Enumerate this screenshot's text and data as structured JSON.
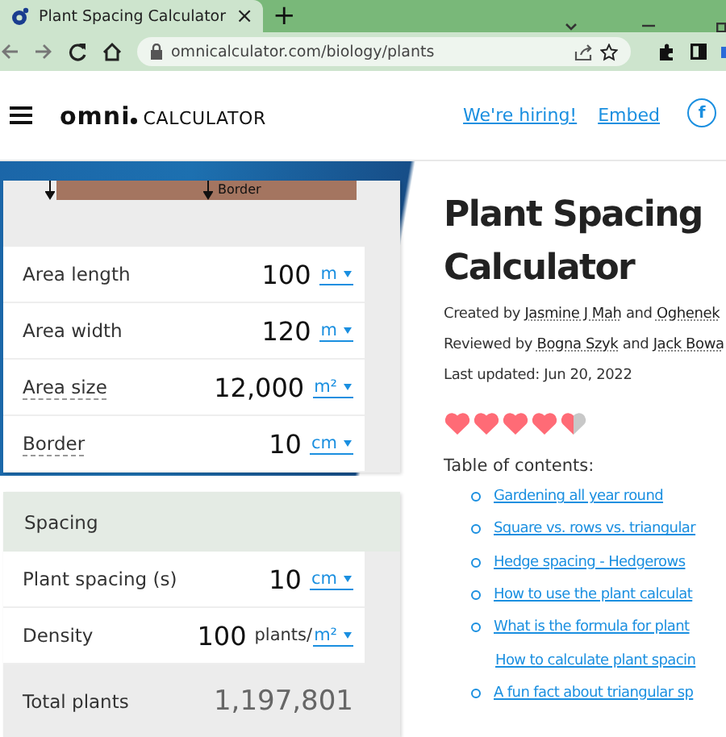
{
  "browser": {
    "tab": {
      "title": "Plant Spacing Calculator",
      "close": "×"
    },
    "new_tab": "+",
    "url": "omnicalculator.com/biology/plants"
  },
  "header": {
    "logo_word": "omni",
    "logo_suffix": "CALCULATOR",
    "links": [
      "We're hiring!",
      "Embed"
    ],
    "social": "f"
  },
  "calculator": {
    "diagram_label": "Border",
    "cards": [
      {
        "rows": [
          {
            "kind": "input",
            "label": "Area length",
            "value": "100",
            "unit": "m",
            "tooltip": false
          },
          {
            "kind": "input",
            "label": "Area width",
            "value": "120",
            "unit": "m",
            "tooltip": false
          },
          {
            "kind": "input",
            "label": "Area size",
            "value": "12,000",
            "unit": "m²",
            "tooltip": true
          },
          {
            "kind": "input",
            "label": "Border",
            "value": "10",
            "unit": "cm",
            "tooltip": true
          }
        ]
      },
      {
        "title": "Spacing",
        "rows": [
          {
            "kind": "input",
            "label": "Plant spacing (s)",
            "value": "10",
            "unit": "cm",
            "tooltip": false
          },
          {
            "kind": "input",
            "label": "Density",
            "value": "100",
            "unit_prefix": "plants/",
            "unit": "m²",
            "tooltip": false
          },
          {
            "kind": "result",
            "label": "Total plants",
            "value": "1,197,801"
          }
        ]
      }
    ]
  },
  "article": {
    "title": "Plant Spacing Calculator",
    "meta": [
      {
        "prefix": "Created by ",
        "people": [
          "Jasmine J Mah",
          "Oghenek"
        ],
        "joiner": " and "
      },
      {
        "prefix": "Reviewed by ",
        "people": [
          "Bogna Szyk",
          "Jack Bowa"
        ],
        "joiner": " and "
      }
    ],
    "updated": "Last updated: Jun 20, 2022",
    "stars": 4.5,
    "toc_title": "Table of contents:",
    "toc": [
      {
        "text": "Gardening all year round",
        "bullet": true
      },
      {
        "text": "Square vs. rows vs. triangular",
        "bullet": true
      },
      {
        "text": "Hedge spacing - Hedgerows",
        "bullet": true
      },
      {
        "text": "How to use the plant calculat",
        "bullet": true
      },
      {
        "text": "What is the formula for plant",
        "bullet": true
      },
      {
        "text": "How to calculate plant spacin",
        "bullet": false
      },
      {
        "text": "A fun fact about triangular sp",
        "bullet": true
      }
    ]
  }
}
